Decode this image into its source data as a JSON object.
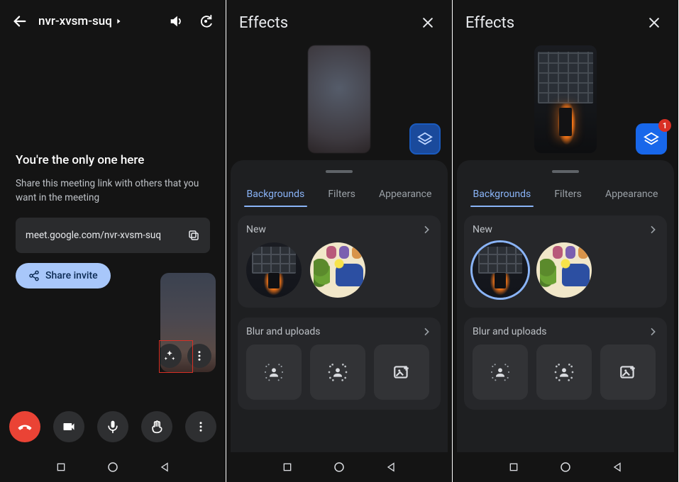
{
  "screen1": {
    "meeting_code": "nvr-xvsm-suq",
    "header": {
      "title": "You're the only one here"
    },
    "subtitle": "Share this meeting link with others that you want in the meeting",
    "meeting_url": "meet.google.com/nvr-xvsm-suq",
    "share_label": "Share invite"
  },
  "screen2": {
    "title": "Effects",
    "tabs": {
      "backgrounds": "Backgrounds",
      "filters": "Filters",
      "appearance": "Appearance"
    },
    "active_tab": "backgrounds",
    "preview_state": "blurred",
    "section_new": "New",
    "section_blur": "Blur and uploads",
    "new_backgrounds": [
      "fireplace",
      "colorful-living-room"
    ],
    "selected_background": null,
    "layers_badge": null
  },
  "screen3": {
    "title": "Effects",
    "tabs": {
      "backgrounds": "Backgrounds",
      "filters": "Filters",
      "appearance": "Appearance"
    },
    "active_tab": "backgrounds",
    "preview_state": "fireplace",
    "section_new": "New",
    "section_blur": "Blur and uploads",
    "new_backgrounds": [
      "fireplace",
      "colorful-living-room"
    ],
    "selected_background": "fireplace",
    "layers_badge": "1"
  }
}
